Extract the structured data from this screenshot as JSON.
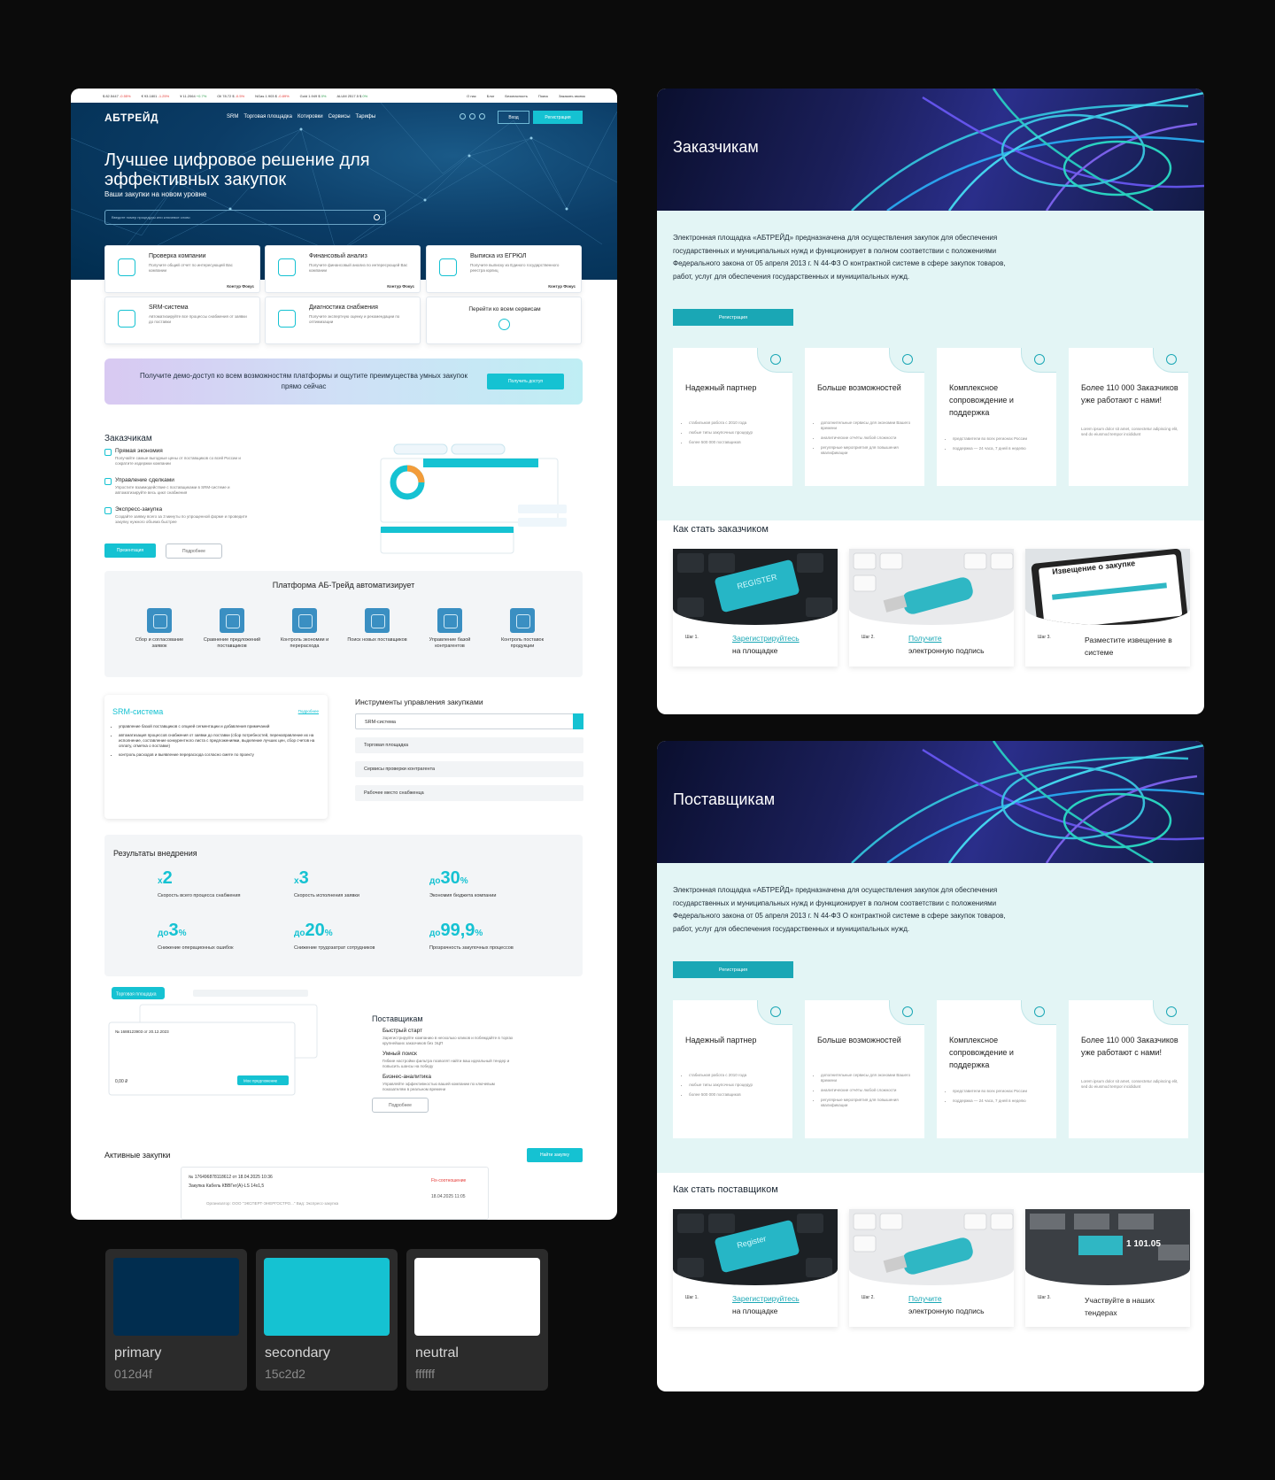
{
  "left_page": {
    "ticker": [
      {
        "t": "$ 82.5447",
        "c": "-0.55%",
        "s": "red"
      },
      {
        "t": "€ 93.1801",
        "c": "-1.25%",
        "s": "red"
      },
      {
        "t": "¥ 11.2064",
        "c": "+0.7%",
        "s": "green"
      },
      {
        "t": "Oil 78.72 $",
        "c": "-0.5%",
        "s": "red"
      },
      {
        "t": "NGas 1.903 $",
        "c": "-0.89%",
        "s": "red"
      },
      {
        "t": "Gold 1.949 $",
        "c": "0%",
        "s": "green"
      },
      {
        "t": "ALUM 2517.5 $",
        "c": "0%",
        "s": "green"
      }
    ],
    "top_links": [
      "О нас",
      "Блог",
      "Безопасность",
      "Поиск",
      "Заказать звонок"
    ],
    "logo": "АБТРЕЙД",
    "nav": [
      "SRM",
      "Торговая площадка",
      "Котировки",
      "Сервисы",
      "Тарифы"
    ],
    "login": "Вход",
    "register": "Регистрация",
    "hero_title": "Лучшее цифровое решение для эффективных закупок",
    "hero_sub": "Ваши закупки на новом уровне",
    "search_placeholder": "Введите номер процедуры или ключевое слово",
    "services": [
      {
        "t": "Проверка компании",
        "d": "Получите общий отчет по интересующей Вас компании",
        "k": "Контур Фокус"
      },
      {
        "t": "Финансовый анализ",
        "d": "Получите финансовый анализ по интересующей Вас компании",
        "k": "Контур Фокус"
      },
      {
        "t": "Выписка из ЕГРЮЛ",
        "d": "Получите выписку из Единого государственного реестра юрлиц",
        "k": "Контур Фокус"
      },
      {
        "t": "SRM-система",
        "d": "Автоматизируйте все процессы снабжения от заявки до поставки",
        "k": ""
      },
      {
        "t": "Диагностика снабжения",
        "d": "Получите экспертную оценку и рекомендации по оптимизации",
        "k": ""
      },
      {
        "t": "Перейти ко всем сервисам",
        "d": "",
        "k": ""
      }
    ],
    "demo_text": "Получите демо-доступ ко всем возможностям платформы и ощутите преимущества умных закупок прямо сейчас",
    "demo_btn": "Получить доступ",
    "customers_title": "Заказчикам",
    "customer_feats": [
      {
        "t": "Прямая экономия",
        "d": "Получайте самые выгодные цены от поставщиков со всей России и сократите издержки компании"
      },
      {
        "t": "Управление сделками",
        "d": "Упростите взаимодействие с поставщиками в SRM-системе и автоматизируйте весь цикл снабжения"
      },
      {
        "t": "Экспресс-закупка",
        "d": "Создайте заявку всего за 3 минуты по упрощенной форме и проведите закупку нужного объема быстрее"
      }
    ],
    "btn_presentation": "Презентация",
    "btn_more": "Подробнее",
    "platform_title": "Платформа АБ-Трейд автоматизирует",
    "platform_items": [
      "Сбор и согласование заявок",
      "Сравнение предложений поставщиков",
      "Контроль экономии и перерасхода",
      "Поиск новых поставщиков",
      "Управление базой контрагентов",
      "Контроль поставок продукции"
    ],
    "srm_title": "SRM-система",
    "srm_more": "Подробнее",
    "srm_points": [
      "управление базой поставщиков с опцией сегментации и добавления примечаний",
      "автоматизация процессов снабжения от заявки до поставки (сбор потребностей, перенаправление их на исполнение, составление конкурентного листа с предложениями, выделение лучших цен, сбор счетов на оплату, отметка о поставке)",
      "контроль расходов и выявление перерасхода согласно смете по проекту"
    ],
    "tools_title": "Инструменты управления закупками",
    "tools": [
      "SRM-система",
      "Торговая площадка",
      "Сервисы проверки контрагента",
      "Рабочее место снабженца"
    ],
    "results_title": "Результаты внедрения",
    "results": [
      {
        "pre": "x",
        "n": "2",
        "suf": "",
        "l": "Скорость всего процесса снабжения"
      },
      {
        "pre": "x",
        "n": "3",
        "suf": "",
        "l": "Скорость исполнения заявки"
      },
      {
        "pre": "до",
        "n": "30",
        "suf": "%",
        "l": "Экономия бюджета компании"
      },
      {
        "pre": "до",
        "n": "3",
        "suf": "%",
        "l": "Снижение операционных ошибок"
      },
      {
        "pre": "до",
        "n": "20",
        "suf": "%",
        "l": "Снижение трудозатрат сотрудников"
      },
      {
        "pre": "до",
        "n": "99,9",
        "suf": "%",
        "l": "Прозрачность закупочных процессов"
      }
    ],
    "suppliers_title": "Поставщикам",
    "supplier_feats": [
      {
        "t": "Быстрый старт",
        "d": "Зарегистрируйте компанию в несколько кликов и побеждайте в торгах крупнейших заказчиков без ЭЦП"
      },
      {
        "t": "Умный поиск",
        "d": "Гибкие настройки фильтра позволят найти ваш идеальный тендер и повысить шансы на победу"
      },
      {
        "t": "Бизнес-аналитика",
        "d": "Управляйте эффективностью вашей компании по ключевым показателям в реальном времени"
      }
    ],
    "mock_tab": "Торговая площадка",
    "mock_lot": "№ 1688123903 от 20.12.2023",
    "mock_price": "0,00 ₽",
    "mock_btn": "Мое предложение",
    "active_title": "Активные закупки",
    "find_btn": "Найти закупку",
    "active_lot": "№ 176496878118612 от 18.04.2025 10:36",
    "active_item": "Закупка Кабель КВВГнг(А)-LS 14х1,5",
    "active_status": "Fix-соотношение",
    "active_org": "Организатор: ООО \"ЭКСПЕРТ-ЭНЕРГОСТРО...\" Вид: Экспресс-закупка",
    "active_date": "18.04.2025 11:05"
  },
  "panels": [
    {
      "title": "Заказчикам",
      "desc": "Электронная площадка «АБТРЕЙД» предназначена для осуществления закупок для обеспечения государственных и муниципальных нужд и функционирует в полном соответствии с положениями Федерального закона от 05 апреля 2013 г. N 44-ФЗ О контрактной системе в сфере закупок товаров, работ, услуг для обеспечения государственных и муниципальных нужд.",
      "reg": "Регистрация",
      "benefits": [
        {
          "h": "Надежный партнер",
          "items": [
            "стабильная работа с 2010 года",
            "любые типы закупочных процедур",
            "более 500 000 поставщиков"
          ]
        },
        {
          "h": "Больше возможностей",
          "items": [
            "дополнительные сервисы для экономии Вашего времени",
            "аналитические отчёты любой сложности",
            "регулярные мероприятия для повышения квалификации"
          ]
        },
        {
          "h": "Комплексное сопровождение и поддержка",
          "items": [
            "представители во всех регионах России",
            "поддержка — 24 часа, 7 дней в неделю"
          ]
        },
        {
          "h": "Более 110 000 Заказчиков уже работают с нами!",
          "lorem": "Lorem ipsum dolor sit amet, consectetur adipiscing elit, sed do eiusmod tempor incididunt"
        }
      ],
      "how": "Как стать заказчиком",
      "steps": [
        {
          "n": "Шаг 1.",
          "a": "Зарегистрируйтесь",
          "b": "на площадке",
          "img": "REGISTER"
        },
        {
          "n": "Шаг 2.",
          "a": "Получите",
          "b": "электронную подпись",
          "img": ""
        },
        {
          "n": "Шаг 3.",
          "a": "",
          "b": "Разместите извещение в системе",
          "img": "Извещение о закупке"
        }
      ]
    },
    {
      "title": "Поставщикам",
      "desc": "Электронная площадка «АБТРЕЙД» предназначена для осуществления закупок для обеспечения государственных и муниципальных нужд и функционирует в полном соответствии с положениями Федерального закона от 05 апреля 2013 г. N 44-ФЗ О контрактной системе в сфере закупок товаров, работ, услуг для обеспечения государственных и муниципальных нужд.",
      "reg": "Регистрация",
      "benefits": [
        {
          "h": "Надежный партнер",
          "items": [
            "стабильная работа с 2010 года",
            "любые типы закупочных процедур",
            "более 500 000 поставщиков"
          ]
        },
        {
          "h": "Больше возможностей",
          "items": [
            "дополнительные сервисы для экономии Вашего времени",
            "аналитические отчёты любой сложности",
            "регулярные мероприятия для повышения квалификации"
          ]
        },
        {
          "h": "Комплексное сопровождение и поддержка",
          "items": [
            "представители во всех регионах России",
            "поддержка — 24 часа, 7 дней в неделю"
          ]
        },
        {
          "h": "Более 110 000 Заказчиков уже работают с нами!",
          "lorem": "Lorem ipsum dolor sit amet, consectetur adipiscing elit, sed do eiusmod tempor incididunt"
        }
      ],
      "how": "Как стать поставщиком",
      "steps": [
        {
          "n": "Шаг 1.",
          "a": "Зарегистрируйтесь",
          "b": "на площадке",
          "img": "Register"
        },
        {
          "n": "Шаг 2.",
          "a": "Получите",
          "b": "электронную подпись",
          "img": ""
        },
        {
          "n": "Шаг 3.",
          "a": "",
          "b": "Участвуйте в наших тендерах",
          "img": "1 101.05"
        }
      ]
    }
  ],
  "swatches": [
    {
      "name": "primary",
      "hex": "012d4f",
      "color": "#012d4f"
    },
    {
      "name": "secondary",
      "hex": "15c2d2",
      "color": "#15c2d2"
    },
    {
      "name": "neutral",
      "hex": "ffffff",
      "color": "#ffffff"
    }
  ]
}
